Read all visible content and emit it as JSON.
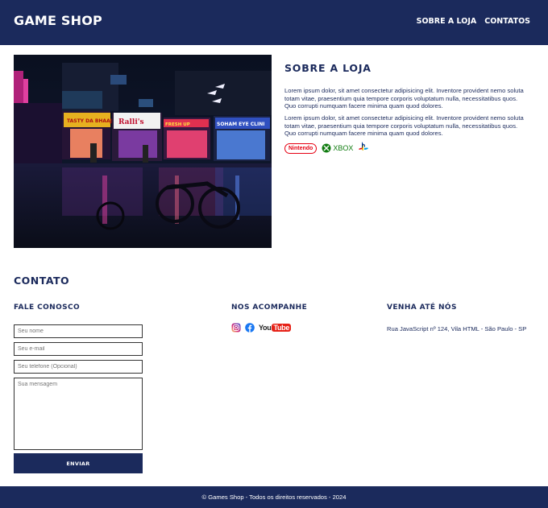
{
  "header": {
    "logo": "GAME SHOP",
    "nav": [
      "SOBRE A LOJA",
      "CONTATOS"
    ]
  },
  "about": {
    "title": "SOBRE A LOJA",
    "paragraphs": [
      "Lorem ipsum dolor, sit amet consectetur adipisicing elit. Inventore provident nemo soluta totam vitae, praesentium quia tempore corporis voluptatum nulla, necessitatibus quos. Quo corrupti numquam facere minima quam quod dolores.",
      "Lorem ipsum dolor, sit amet consectetur adipisicing elit. Inventore provident nemo soluta totam vitae, praesentium quia tempore corporis voluptatum nulla, necessitatibus quos. Quo corrupti numquam facere minima quam quod dolores."
    ],
    "brands": {
      "nintendo": "Nintendo",
      "xbox": "XBOX"
    },
    "hero_signs": [
      "TASTY DA BHAAJI",
      "Ralli's",
      "FRESH UP",
      "SOHAM EYE CLINI"
    ]
  },
  "contact": {
    "title": "CONTATO",
    "form": {
      "title": "FALE CONOSCO",
      "name_placeholder": "Seu nome",
      "email_placeholder": "Seu e-mail",
      "phone_placeholder": "Seu telefone (Opcional)",
      "message_placeholder": "Sua mensagem",
      "send_label": "ENVIAR"
    },
    "follow": {
      "title": "NOS ACOMPANHE",
      "youtube_text": "YouTube"
    },
    "visit": {
      "title": "VENHA ATÉ NÓS",
      "address": "Rua JavaScript nº 124, Vila HTML - São Paulo - SP"
    }
  },
  "footer": {
    "text": "© Games Shop - Todos os direitos reservados - 2024"
  },
  "colors": {
    "primary": "#1b2a5c",
    "nintendo_red": "#e60012",
    "xbox_green": "#107c10",
    "playstation_blue": "#003791"
  }
}
